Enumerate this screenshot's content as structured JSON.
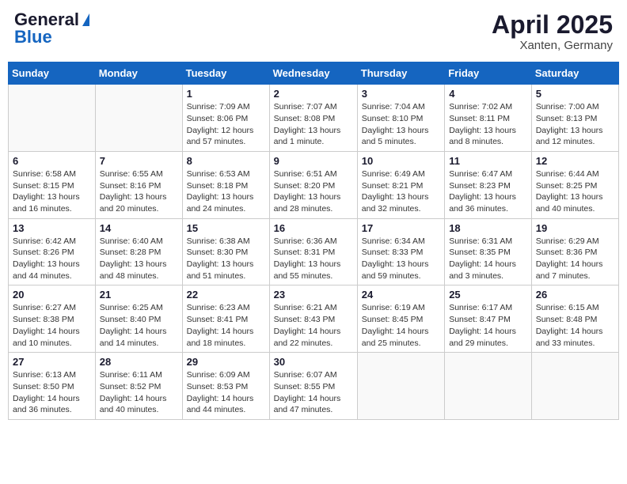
{
  "logo": {
    "general": "General",
    "blue": "Blue"
  },
  "title": "April 2025",
  "location": "Xanten, Germany",
  "days_of_week": [
    "Sunday",
    "Monday",
    "Tuesday",
    "Wednesday",
    "Thursday",
    "Friday",
    "Saturday"
  ],
  "weeks": [
    [
      {
        "day": "",
        "sunrise": "",
        "sunset": "",
        "daylight": ""
      },
      {
        "day": "",
        "sunrise": "",
        "sunset": "",
        "daylight": ""
      },
      {
        "day": "1",
        "sunrise": "Sunrise: 7:09 AM",
        "sunset": "Sunset: 8:06 PM",
        "daylight": "Daylight: 12 hours and 57 minutes."
      },
      {
        "day": "2",
        "sunrise": "Sunrise: 7:07 AM",
        "sunset": "Sunset: 8:08 PM",
        "daylight": "Daylight: 13 hours and 1 minute."
      },
      {
        "day": "3",
        "sunrise": "Sunrise: 7:04 AM",
        "sunset": "Sunset: 8:10 PM",
        "daylight": "Daylight: 13 hours and 5 minutes."
      },
      {
        "day": "4",
        "sunrise": "Sunrise: 7:02 AM",
        "sunset": "Sunset: 8:11 PM",
        "daylight": "Daylight: 13 hours and 8 minutes."
      },
      {
        "day": "5",
        "sunrise": "Sunrise: 7:00 AM",
        "sunset": "Sunset: 8:13 PM",
        "daylight": "Daylight: 13 hours and 12 minutes."
      }
    ],
    [
      {
        "day": "6",
        "sunrise": "Sunrise: 6:58 AM",
        "sunset": "Sunset: 8:15 PM",
        "daylight": "Daylight: 13 hours and 16 minutes."
      },
      {
        "day": "7",
        "sunrise": "Sunrise: 6:55 AM",
        "sunset": "Sunset: 8:16 PM",
        "daylight": "Daylight: 13 hours and 20 minutes."
      },
      {
        "day": "8",
        "sunrise": "Sunrise: 6:53 AM",
        "sunset": "Sunset: 8:18 PM",
        "daylight": "Daylight: 13 hours and 24 minutes."
      },
      {
        "day": "9",
        "sunrise": "Sunrise: 6:51 AM",
        "sunset": "Sunset: 8:20 PM",
        "daylight": "Daylight: 13 hours and 28 minutes."
      },
      {
        "day": "10",
        "sunrise": "Sunrise: 6:49 AM",
        "sunset": "Sunset: 8:21 PM",
        "daylight": "Daylight: 13 hours and 32 minutes."
      },
      {
        "day": "11",
        "sunrise": "Sunrise: 6:47 AM",
        "sunset": "Sunset: 8:23 PM",
        "daylight": "Daylight: 13 hours and 36 minutes."
      },
      {
        "day": "12",
        "sunrise": "Sunrise: 6:44 AM",
        "sunset": "Sunset: 8:25 PM",
        "daylight": "Daylight: 13 hours and 40 minutes."
      }
    ],
    [
      {
        "day": "13",
        "sunrise": "Sunrise: 6:42 AM",
        "sunset": "Sunset: 8:26 PM",
        "daylight": "Daylight: 13 hours and 44 minutes."
      },
      {
        "day": "14",
        "sunrise": "Sunrise: 6:40 AM",
        "sunset": "Sunset: 8:28 PM",
        "daylight": "Daylight: 13 hours and 48 minutes."
      },
      {
        "day": "15",
        "sunrise": "Sunrise: 6:38 AM",
        "sunset": "Sunset: 8:30 PM",
        "daylight": "Daylight: 13 hours and 51 minutes."
      },
      {
        "day": "16",
        "sunrise": "Sunrise: 6:36 AM",
        "sunset": "Sunset: 8:31 PM",
        "daylight": "Daylight: 13 hours and 55 minutes."
      },
      {
        "day": "17",
        "sunrise": "Sunrise: 6:34 AM",
        "sunset": "Sunset: 8:33 PM",
        "daylight": "Daylight: 13 hours and 59 minutes."
      },
      {
        "day": "18",
        "sunrise": "Sunrise: 6:31 AM",
        "sunset": "Sunset: 8:35 PM",
        "daylight": "Daylight: 14 hours and 3 minutes."
      },
      {
        "day": "19",
        "sunrise": "Sunrise: 6:29 AM",
        "sunset": "Sunset: 8:36 PM",
        "daylight": "Daylight: 14 hours and 7 minutes."
      }
    ],
    [
      {
        "day": "20",
        "sunrise": "Sunrise: 6:27 AM",
        "sunset": "Sunset: 8:38 PM",
        "daylight": "Daylight: 14 hours and 10 minutes."
      },
      {
        "day": "21",
        "sunrise": "Sunrise: 6:25 AM",
        "sunset": "Sunset: 8:40 PM",
        "daylight": "Daylight: 14 hours and 14 minutes."
      },
      {
        "day": "22",
        "sunrise": "Sunrise: 6:23 AM",
        "sunset": "Sunset: 8:41 PM",
        "daylight": "Daylight: 14 hours and 18 minutes."
      },
      {
        "day": "23",
        "sunrise": "Sunrise: 6:21 AM",
        "sunset": "Sunset: 8:43 PM",
        "daylight": "Daylight: 14 hours and 22 minutes."
      },
      {
        "day": "24",
        "sunrise": "Sunrise: 6:19 AM",
        "sunset": "Sunset: 8:45 PM",
        "daylight": "Daylight: 14 hours and 25 minutes."
      },
      {
        "day": "25",
        "sunrise": "Sunrise: 6:17 AM",
        "sunset": "Sunset: 8:47 PM",
        "daylight": "Daylight: 14 hours and 29 minutes."
      },
      {
        "day": "26",
        "sunrise": "Sunrise: 6:15 AM",
        "sunset": "Sunset: 8:48 PM",
        "daylight": "Daylight: 14 hours and 33 minutes."
      }
    ],
    [
      {
        "day": "27",
        "sunrise": "Sunrise: 6:13 AM",
        "sunset": "Sunset: 8:50 PM",
        "daylight": "Daylight: 14 hours and 36 minutes."
      },
      {
        "day": "28",
        "sunrise": "Sunrise: 6:11 AM",
        "sunset": "Sunset: 8:52 PM",
        "daylight": "Daylight: 14 hours and 40 minutes."
      },
      {
        "day": "29",
        "sunrise": "Sunrise: 6:09 AM",
        "sunset": "Sunset: 8:53 PM",
        "daylight": "Daylight: 14 hours and 44 minutes."
      },
      {
        "day": "30",
        "sunrise": "Sunrise: 6:07 AM",
        "sunset": "Sunset: 8:55 PM",
        "daylight": "Daylight: 14 hours and 47 minutes."
      },
      {
        "day": "",
        "sunrise": "",
        "sunset": "",
        "daylight": ""
      },
      {
        "day": "",
        "sunrise": "",
        "sunset": "",
        "daylight": ""
      },
      {
        "day": "",
        "sunrise": "",
        "sunset": "",
        "daylight": ""
      }
    ]
  ]
}
